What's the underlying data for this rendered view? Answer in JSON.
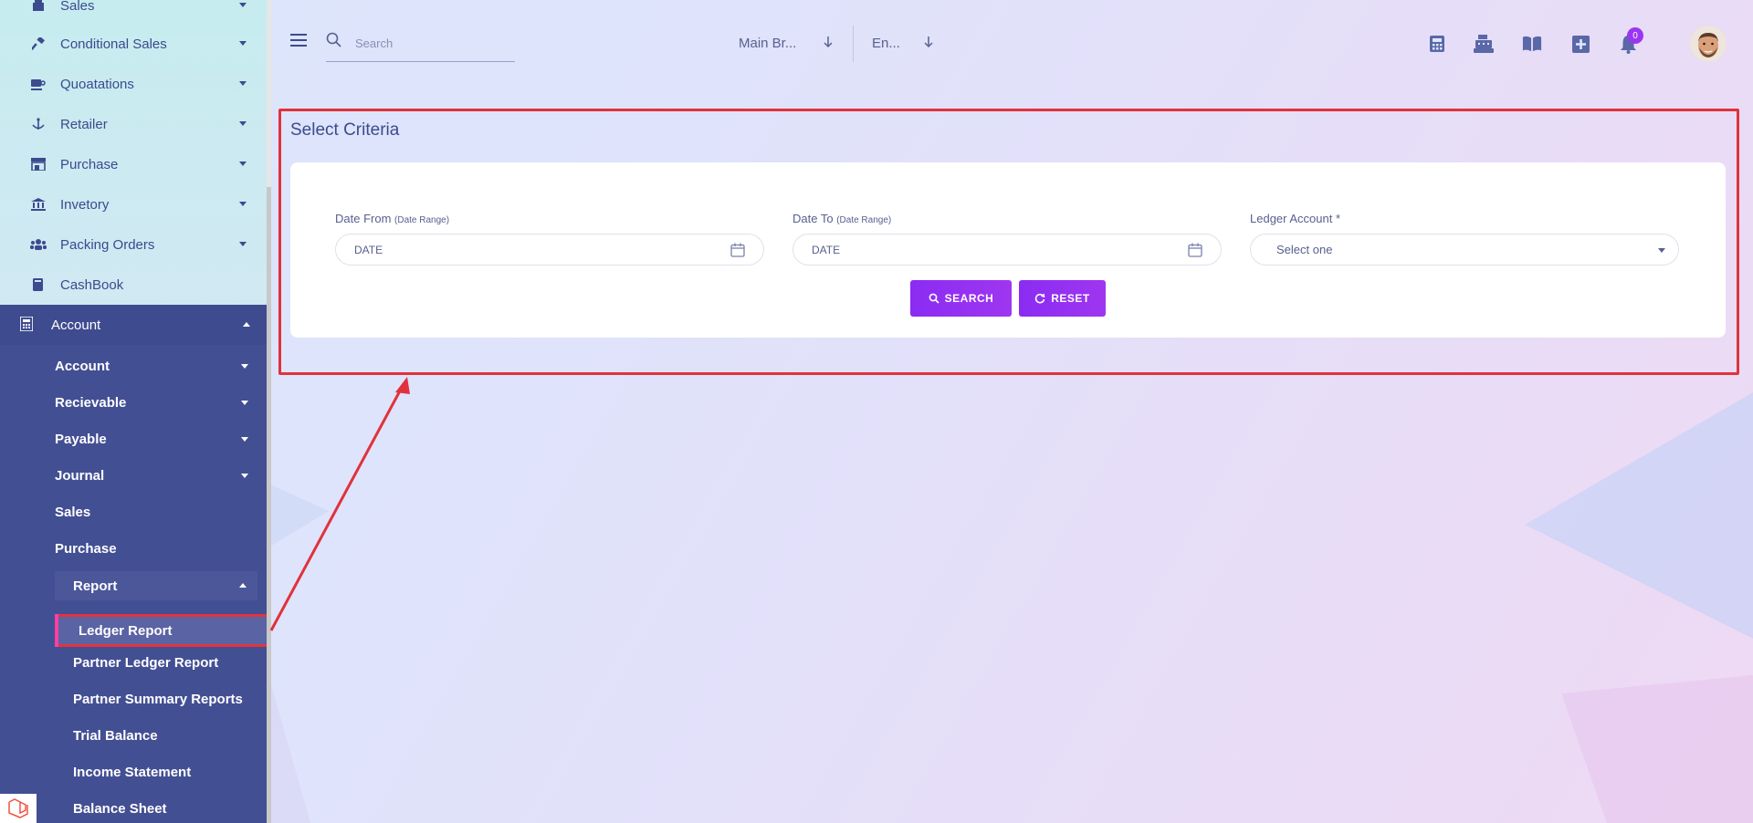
{
  "sidebar": {
    "items": [
      {
        "label": "Sales",
        "icon": "register-icon"
      },
      {
        "label": "Conditional Sales",
        "icon": "hammer-icon"
      },
      {
        "label": "Quoatations",
        "icon": "coffee-icon"
      },
      {
        "label": "Retailer",
        "icon": "anchor-icon"
      },
      {
        "label": "Purchase",
        "icon": "store-icon"
      },
      {
        "label": "Invetory",
        "icon": "bank-icon"
      },
      {
        "label": "Packing Orders",
        "icon": "users-icon"
      },
      {
        "label": "CashBook",
        "icon": "book-icon"
      }
    ],
    "account": {
      "label": "Account",
      "icon": "calculator-icon",
      "children": [
        "Account",
        "Recievable",
        "Payable",
        "Journal",
        "Sales",
        "Purchase"
      ],
      "report": {
        "label": "Report",
        "active": "Ledger Report",
        "children": [
          "Partner Ledger Report",
          "Partner Summary Reports",
          "Trial Balance",
          "Income Statement",
          "Balance Sheet"
        ]
      }
    }
  },
  "topbar": {
    "search_placeholder": "Search",
    "branch": "Main Br...",
    "language": "En...",
    "notification_count": "0",
    "icons": [
      "calculator-icon",
      "cash-register-icon",
      "book-open-icon",
      "plus-square-icon",
      "bell-icon"
    ]
  },
  "criteria": {
    "title": "Select Criteria",
    "date_from_label": "Date From",
    "date_to_label": "Date To",
    "range_hint": "(Date Range)",
    "date_placeholder": "DATE",
    "ledger_label": "Ledger Account *",
    "ledger_value": "Select one",
    "search_button": "SEARCH",
    "reset_button": "RESET"
  },
  "colors": {
    "accent": "#9b36f0",
    "sidebar_active": "#434f93",
    "highlight": "#e0323c"
  }
}
